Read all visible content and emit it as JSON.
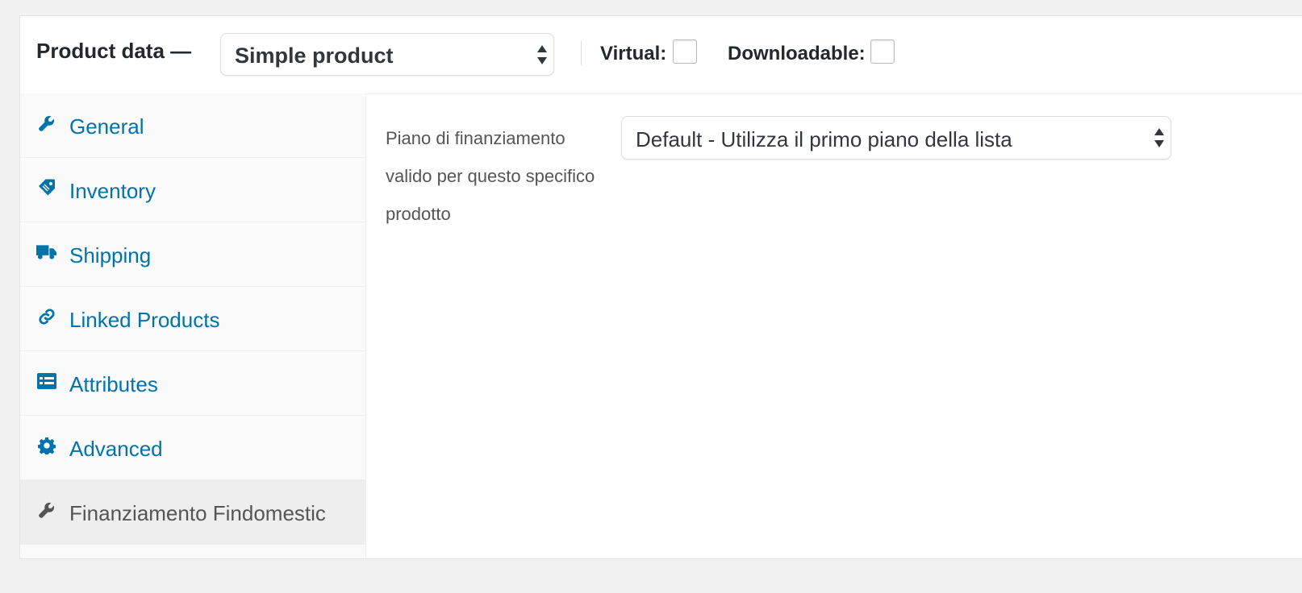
{
  "header": {
    "title": "Product data —",
    "product_type": "Simple product",
    "virtual_label": "Virtual:",
    "virtual_checked": false,
    "downloadable_label": "Downloadable:",
    "downloadable_checked": false
  },
  "tabs": [
    {
      "label": "General",
      "icon": "wrench-icon"
    },
    {
      "label": "Inventory",
      "icon": "tag-icon"
    },
    {
      "label": "Shipping",
      "icon": "truck-icon"
    },
    {
      "label": "Linked Products",
      "icon": "link-icon"
    },
    {
      "label": "Attributes",
      "icon": "list-icon"
    },
    {
      "label": "Advanced",
      "icon": "gear-icon"
    },
    {
      "label": "Finanziamento Findomestic",
      "icon": "wrench-icon",
      "active": true
    }
  ],
  "panel": {
    "field_label": "Piano di finanziamento valido per questo specifico prodotto",
    "plan_select_value": "Default - Utilizza il primo piano della lista"
  },
  "colors": {
    "link": "#0073aa",
    "active_tab_bg": "#eeeeee",
    "text": "#23282d",
    "muted": "#555555"
  }
}
